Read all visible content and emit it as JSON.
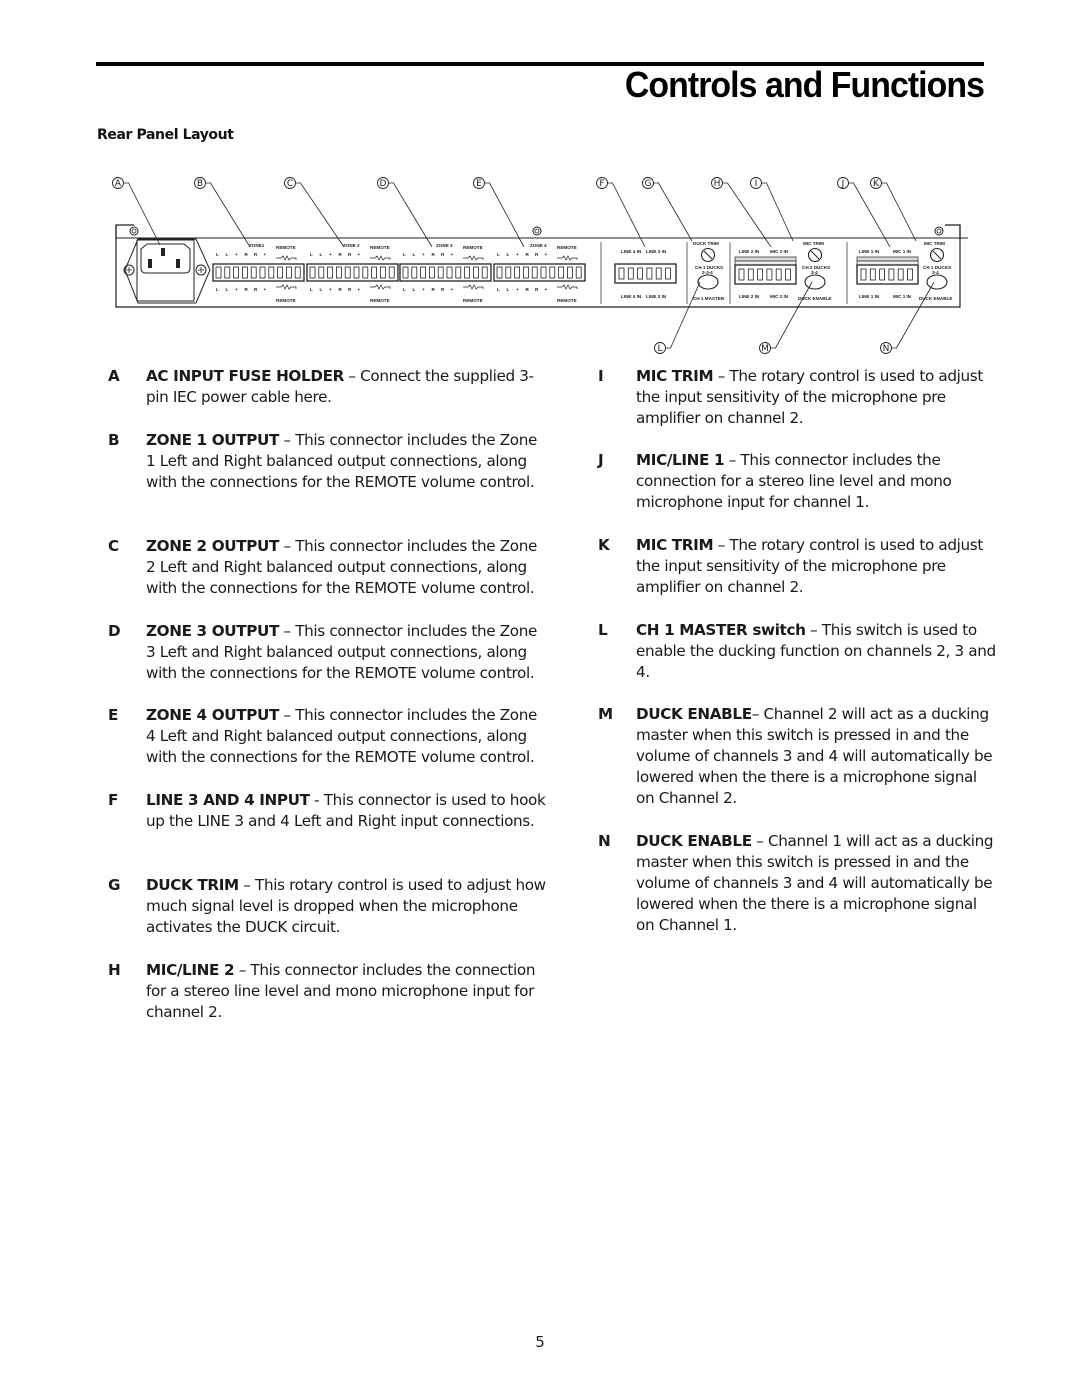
{
  "page": {
    "title": "Controls and Functions",
    "section_heading": "Rear Panel Layout",
    "page_number": "5"
  },
  "diagram": {
    "callouts_top": [
      "A",
      "B",
      "C",
      "D",
      "E",
      "F",
      "G",
      "H",
      "I",
      "J",
      "K"
    ],
    "callouts_bottom": [
      "L",
      "M",
      "N"
    ],
    "zone_labels": [
      "ZONE1",
      "ZONE 2",
      "ZONE 3",
      "ZONE 4"
    ],
    "remote_label": "REMOTE",
    "zone_pin_labels": [
      "L",
      "L",
      "+",
      "R",
      "R",
      "+"
    ],
    "line_in_labels": [
      "LINE 4 IN",
      "LINE 3 IN"
    ],
    "duck_trim_label": "DUCK TRIM",
    "ch1_ducks_label": "CH 1 DUCKS",
    "ch1_ducks_sub": "2-3-4",
    "ch1_master_label": "CH 1 MASTER",
    "mic_trim_label": "MIC TRIM",
    "line2_label": "LINE 2 IN",
    "mic2_label": "MIC 2 IN",
    "ch2_ducks_label": "CH 2 DUCKS",
    "ch2_ducks_sub": "3-4",
    "duck_enable_label": "DUCK ENABLE",
    "line1_label": "LINE 1 IN",
    "mic1_label": "MIC 1 IN",
    "ch1_ducks2_label": "CH 1 DUCKS",
    "ch1_ducks2_sub": "3-4"
  },
  "items_left": [
    {
      "letter": "A",
      "term": "AC INPUT FUSE HOLDER",
      "text": " – Connect the supplied 3-pin IEC power cable here."
    },
    {
      "letter": "B",
      "term": "ZONE 1 OUTPUT",
      "text": " – This connector includes the Zone 1 Left and Right balanced output connections, along with the connections for the REMOTE volume control."
    },
    {
      "letter": "C",
      "term": "ZONE 2 OUTPUT",
      "text": " – This connector includes the Zone 2 Left and Right balanced output connections, along with the connections for the REMOTE volume control."
    },
    {
      "letter": "D",
      "term": "ZONE 3 OUTPUT",
      "text": " – This connector includes the Zone 3 Left and Right balanced output connections, along with the connections for the REMOTE volume control."
    },
    {
      "letter": "E",
      "term": "ZONE 4 OUTPUT",
      "text": " – This connector includes the Zone 4 Left and Right balanced output connections, along with the connections for the REMOTE volume control."
    },
    {
      "letter": "F",
      "term": "LINE 3 AND 4 INPUT",
      "text": "  - This connector is used to hook up the LINE 3 and 4 Left and Right input connections."
    },
    {
      "letter": "G",
      "term": "DUCK TRIM",
      "text": " – This rotary control is used to adjust how much signal level is dropped when the microphone activates the DUCK circuit."
    },
    {
      "letter": "H",
      "term": "MIC/LINE 2",
      "text": " – This connector includes the connection for a stereo line level and mono microphone input for channel 2."
    }
  ],
  "items_right": [
    {
      "letter": "I",
      "term": "MIC TRIM",
      "text": " – The rotary control is used to adjust the input sensitivity of the microphone pre amplifier on channel 2."
    },
    {
      "letter": "J",
      "term": "MIC/LINE 1",
      "text": " – This connector includes the connection for a stereo line level and mono microphone input for channel 1."
    },
    {
      "letter": "K",
      "term": "MIC TRIM",
      "text": " – The rotary control is used to adjust the input sensitivity of the microphone pre amplifier on channel 2."
    },
    {
      "letter": "L",
      "term": "CH 1 MASTER switch",
      "text": "  – This switch is used to enable the ducking function on channels 2, 3 and 4."
    },
    {
      "letter": "M",
      "term": "DUCK ENABLE",
      "text": "– Channel 2 will act as a ducking master when this switch is pressed in and the volume of channels 3 and 4 will automatically be lowered when the there is a microphone signal on Channel 2."
    },
    {
      "letter": "N",
      "term": "DUCK ENABLE",
      "text": " – Channel 1 will act as a ducking master when this switch is pressed in and the volume of channels 3 and 4 will automatically be lowered when the there is a microphone signal on Channel 1."
    }
  ]
}
